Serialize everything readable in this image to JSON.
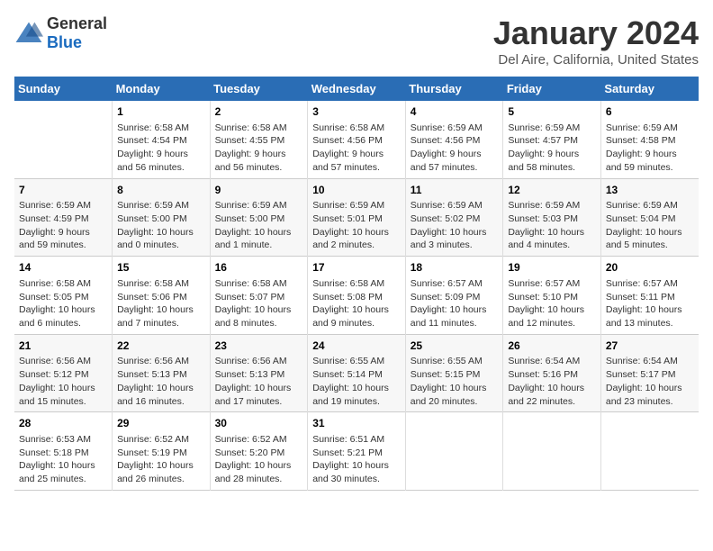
{
  "logo": {
    "general": "General",
    "blue": "Blue"
  },
  "header": {
    "month": "January 2024",
    "location": "Del Aire, California, United States"
  },
  "weekdays": [
    "Sunday",
    "Monday",
    "Tuesday",
    "Wednesday",
    "Thursday",
    "Friday",
    "Saturday"
  ],
  "weeks": [
    [
      {
        "day": "",
        "info": ""
      },
      {
        "day": "1",
        "info": "Sunrise: 6:58 AM\nSunset: 4:54 PM\nDaylight: 9 hours\nand 56 minutes."
      },
      {
        "day": "2",
        "info": "Sunrise: 6:58 AM\nSunset: 4:55 PM\nDaylight: 9 hours\nand 56 minutes."
      },
      {
        "day": "3",
        "info": "Sunrise: 6:58 AM\nSunset: 4:56 PM\nDaylight: 9 hours\nand 57 minutes."
      },
      {
        "day": "4",
        "info": "Sunrise: 6:59 AM\nSunset: 4:56 PM\nDaylight: 9 hours\nand 57 minutes."
      },
      {
        "day": "5",
        "info": "Sunrise: 6:59 AM\nSunset: 4:57 PM\nDaylight: 9 hours\nand 58 minutes."
      },
      {
        "day": "6",
        "info": "Sunrise: 6:59 AM\nSunset: 4:58 PM\nDaylight: 9 hours\nand 59 minutes."
      }
    ],
    [
      {
        "day": "7",
        "info": "Sunrise: 6:59 AM\nSunset: 4:59 PM\nDaylight: 9 hours\nand 59 minutes."
      },
      {
        "day": "8",
        "info": "Sunrise: 6:59 AM\nSunset: 5:00 PM\nDaylight: 10 hours\nand 0 minutes."
      },
      {
        "day": "9",
        "info": "Sunrise: 6:59 AM\nSunset: 5:00 PM\nDaylight: 10 hours\nand 1 minute."
      },
      {
        "day": "10",
        "info": "Sunrise: 6:59 AM\nSunset: 5:01 PM\nDaylight: 10 hours\nand 2 minutes."
      },
      {
        "day": "11",
        "info": "Sunrise: 6:59 AM\nSunset: 5:02 PM\nDaylight: 10 hours\nand 3 minutes."
      },
      {
        "day": "12",
        "info": "Sunrise: 6:59 AM\nSunset: 5:03 PM\nDaylight: 10 hours\nand 4 minutes."
      },
      {
        "day": "13",
        "info": "Sunrise: 6:59 AM\nSunset: 5:04 PM\nDaylight: 10 hours\nand 5 minutes."
      }
    ],
    [
      {
        "day": "14",
        "info": "Sunrise: 6:58 AM\nSunset: 5:05 PM\nDaylight: 10 hours\nand 6 minutes."
      },
      {
        "day": "15",
        "info": "Sunrise: 6:58 AM\nSunset: 5:06 PM\nDaylight: 10 hours\nand 7 minutes."
      },
      {
        "day": "16",
        "info": "Sunrise: 6:58 AM\nSunset: 5:07 PM\nDaylight: 10 hours\nand 8 minutes."
      },
      {
        "day": "17",
        "info": "Sunrise: 6:58 AM\nSunset: 5:08 PM\nDaylight: 10 hours\nand 9 minutes."
      },
      {
        "day": "18",
        "info": "Sunrise: 6:57 AM\nSunset: 5:09 PM\nDaylight: 10 hours\nand 11 minutes."
      },
      {
        "day": "19",
        "info": "Sunrise: 6:57 AM\nSunset: 5:10 PM\nDaylight: 10 hours\nand 12 minutes."
      },
      {
        "day": "20",
        "info": "Sunrise: 6:57 AM\nSunset: 5:11 PM\nDaylight: 10 hours\nand 13 minutes."
      }
    ],
    [
      {
        "day": "21",
        "info": "Sunrise: 6:56 AM\nSunset: 5:12 PM\nDaylight: 10 hours\nand 15 minutes."
      },
      {
        "day": "22",
        "info": "Sunrise: 6:56 AM\nSunset: 5:13 PM\nDaylight: 10 hours\nand 16 minutes."
      },
      {
        "day": "23",
        "info": "Sunrise: 6:56 AM\nSunset: 5:13 PM\nDaylight: 10 hours\nand 17 minutes."
      },
      {
        "day": "24",
        "info": "Sunrise: 6:55 AM\nSunset: 5:14 PM\nDaylight: 10 hours\nand 19 minutes."
      },
      {
        "day": "25",
        "info": "Sunrise: 6:55 AM\nSunset: 5:15 PM\nDaylight: 10 hours\nand 20 minutes."
      },
      {
        "day": "26",
        "info": "Sunrise: 6:54 AM\nSunset: 5:16 PM\nDaylight: 10 hours\nand 22 minutes."
      },
      {
        "day": "27",
        "info": "Sunrise: 6:54 AM\nSunset: 5:17 PM\nDaylight: 10 hours\nand 23 minutes."
      }
    ],
    [
      {
        "day": "28",
        "info": "Sunrise: 6:53 AM\nSunset: 5:18 PM\nDaylight: 10 hours\nand 25 minutes."
      },
      {
        "day": "29",
        "info": "Sunrise: 6:52 AM\nSunset: 5:19 PM\nDaylight: 10 hours\nand 26 minutes."
      },
      {
        "day": "30",
        "info": "Sunrise: 6:52 AM\nSunset: 5:20 PM\nDaylight: 10 hours\nand 28 minutes."
      },
      {
        "day": "31",
        "info": "Sunrise: 6:51 AM\nSunset: 5:21 PM\nDaylight: 10 hours\nand 30 minutes."
      },
      {
        "day": "",
        "info": ""
      },
      {
        "day": "",
        "info": ""
      },
      {
        "day": "",
        "info": ""
      }
    ]
  ]
}
